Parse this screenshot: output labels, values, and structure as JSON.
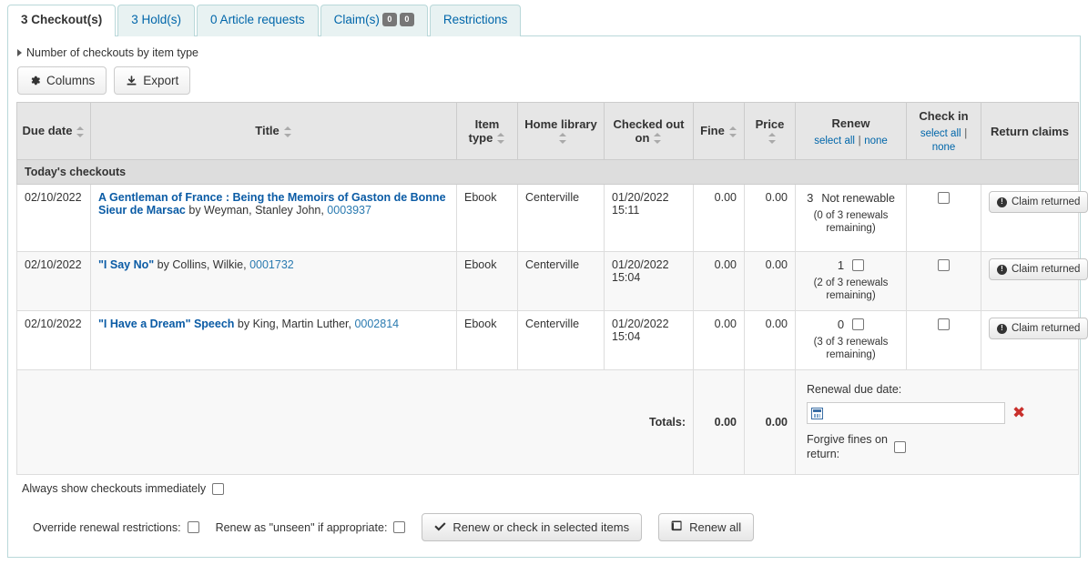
{
  "tabs": [
    {
      "label": "3 Checkout(s)",
      "active": true,
      "badges": []
    },
    {
      "label": "3 Hold(s)",
      "active": false,
      "badges": []
    },
    {
      "label": "0 Article requests",
      "active": false,
      "badges": []
    },
    {
      "label": "Claim(s)",
      "active": false,
      "badges": [
        "0",
        "0"
      ]
    },
    {
      "label": "Restrictions",
      "active": false,
      "badges": []
    }
  ],
  "toolbar": {
    "disclosure_label": "Number of checkouts by item type",
    "columns_label": "Columns",
    "export_label": "Export"
  },
  "table": {
    "headers": {
      "due_date": "Due date",
      "title": "Title",
      "item_type": "Item type",
      "home_library": "Home library",
      "checked_out_on": "Checked out on",
      "fine": "Fine",
      "price": "Price",
      "renew": "Renew",
      "check_in": "Check in",
      "return_claims": "Return claims",
      "select_all": "select all",
      "separator": "|",
      "none": "none"
    },
    "group_label": "Today's checkouts",
    "rows": [
      {
        "due_date": "02/10/2022",
        "title": "A Gentleman of France : Being the Memoirs of Gaston de Bonne Sieur de Marsac",
        "by": " by Weyman, Stanley John, ",
        "barcode": "0003937",
        "item_type": "Ebook",
        "home_library": "Centerville",
        "checked_out_date": "01/20/2022",
        "checked_out_time": "15:11",
        "fine": "0.00",
        "price": "0.00",
        "renew_count": "3",
        "renew_status": "Not renewable",
        "renew_checkbox": false,
        "renew_sub": "(0 of 3 renewals remaining)",
        "claim_label": "Claim returned"
      },
      {
        "due_date": "02/10/2022",
        "title": "\"I Say No\"",
        "by": " by Collins, Wilkie, ",
        "barcode": "0001732",
        "item_type": "Ebook",
        "home_library": "Centerville",
        "checked_out_date": "01/20/2022",
        "checked_out_time": "15:04",
        "fine": "0.00",
        "price": "0.00",
        "renew_count": "1",
        "renew_status": "",
        "renew_checkbox": true,
        "renew_sub": "(2 of 3 renewals remaining)",
        "claim_label": "Claim returned"
      },
      {
        "due_date": "02/10/2022",
        "title": "\"I Have a Dream\" Speech",
        "by": " by King, Martin Luther, ",
        "barcode": "0002814",
        "item_type": "Ebook",
        "home_library": "Centerville",
        "checked_out_date": "01/20/2022",
        "checked_out_time": "15:04",
        "fine": "0.00",
        "price": "0.00",
        "renew_count": "0",
        "renew_status": "",
        "renew_checkbox": true,
        "renew_sub": "(3 of 3 renewals remaining)",
        "claim_label": "Claim returned"
      }
    ],
    "totals": {
      "label": "Totals:",
      "fine": "0.00",
      "price": "0.00",
      "renewal_due_date_label": "Renewal due date:",
      "renewal_due_date_value": "",
      "forgive_label": "Forgive fines on return:"
    }
  },
  "footer": {
    "always_show_label": "Always show checkouts immediately",
    "override_label": "Override renewal restrictions:",
    "renew_unseen_label": "Renew as \"unseen\" if appropriate:",
    "renew_selected_label": "Renew or check in selected items",
    "renew_all_label": "Renew all"
  },
  "colors": {
    "tab_border": "#b9d8d9",
    "tab_bg": "#e8f2f2",
    "link": "#0066aa",
    "title_link": "#0a5ba5",
    "header_bg": "#e6e6e6",
    "group_bg": "#dddddd",
    "danger": "#c9302c"
  }
}
